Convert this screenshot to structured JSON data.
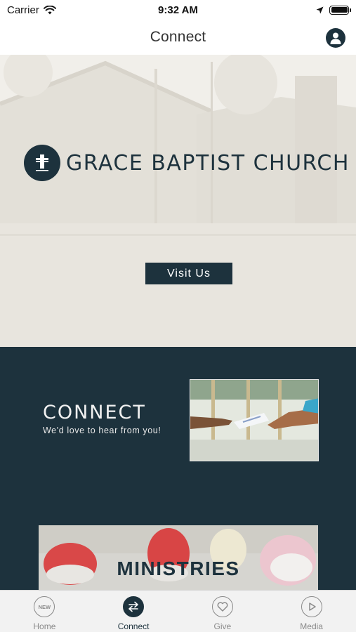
{
  "status_bar": {
    "carrier": "Carrier",
    "time": "9:32 AM"
  },
  "nav": {
    "title": "Connect",
    "profile_icon": "person-icon"
  },
  "hero": {
    "church_name": "GRACE BAPTIST CHURCH",
    "logo_icon": "cross-icon",
    "visit_button": "Visit Us"
  },
  "connect": {
    "title": "CONNECT",
    "subtitle": "We'd love to hear from you!"
  },
  "ministries": {
    "title": "MINISTRIES"
  },
  "tabs": [
    {
      "label": "Home",
      "icon": "new-badge-icon",
      "active": false,
      "badge": "NEW"
    },
    {
      "label": "Connect",
      "icon": "swap-arrows-icon",
      "active": true
    },
    {
      "label": "Give",
      "icon": "heart-icon",
      "active": false
    },
    {
      "label": "Media",
      "icon": "play-icon",
      "active": false
    }
  ],
  "colors": {
    "brand": "#1d323d",
    "tab_inactive": "#8a8a8a",
    "hero_bg": "#e9e6df"
  }
}
